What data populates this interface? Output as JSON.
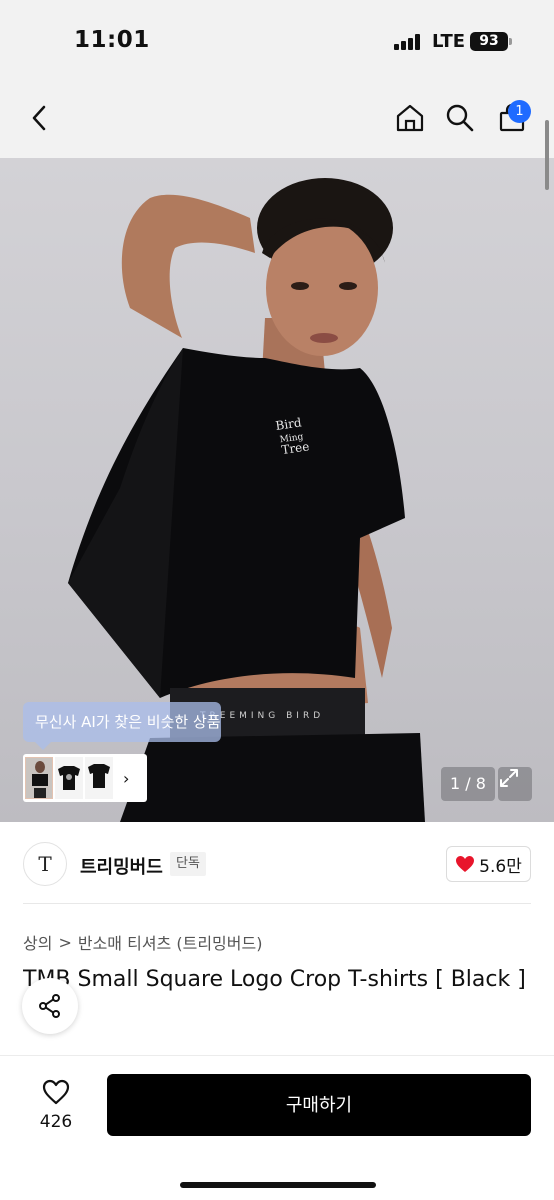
{
  "status": {
    "time": "11:01",
    "network": "LTE",
    "battery": "93"
  },
  "header": {
    "cart_count": "1"
  },
  "gallery": {
    "ai_tip": "무신사 AI가 찾은 비슷한 상품",
    "counter": "1 / 8",
    "shirt_print": [
      "Bird",
      "Ming",
      "Tree"
    ],
    "waistband_text": "TREEMING BIRD"
  },
  "brand": {
    "logo_letter": "T",
    "name": "트리밍버드",
    "badge": "단독",
    "likes": "5.6만"
  },
  "breadcrumb": {
    "category": "상의",
    "separator": ">",
    "subcategory": "반소매 티셔츠 (트리밍버드)"
  },
  "product": {
    "title": "TMB Small Square Logo Crop T-shirts [ Black ]"
  },
  "bottom": {
    "wish_count": "426",
    "buy_label": "구매하기"
  },
  "colors": {
    "buy_button": "#000000",
    "badge": "#1f6bff",
    "heart": "#e8152b"
  }
}
